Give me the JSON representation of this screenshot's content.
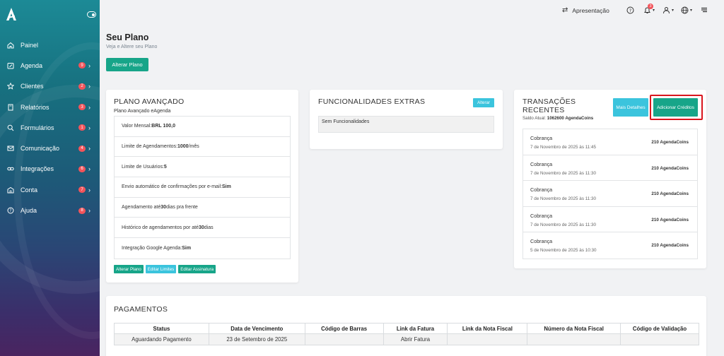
{
  "sidebar": {
    "items": [
      {
        "label": "Painel",
        "icon": "home-icon",
        "badge": ""
      },
      {
        "label": "Agenda",
        "icon": "calendar-edit-icon",
        "badge": "9"
      },
      {
        "label": "Clientes",
        "icon": "star-icon",
        "badge": "2"
      },
      {
        "label": "Relatórios",
        "icon": "book-icon",
        "badge": "3"
      },
      {
        "label": "Formulários",
        "icon": "search-icon",
        "badge": "1"
      },
      {
        "label": "Comunicação",
        "icon": "mail-icon",
        "badge": "4"
      },
      {
        "label": "Integrações",
        "icon": "link-icon",
        "badge": "6"
      },
      {
        "label": "Conta",
        "icon": "building-icon",
        "badge": "7"
      },
      {
        "label": "Ajuda",
        "icon": "help-icon",
        "badge": "8"
      }
    ]
  },
  "topbar": {
    "presentation_label": "Apresentação",
    "notification_count": "3"
  },
  "header": {
    "title": "Seu Plano",
    "subtitle": "Veja e Altere seu Plano",
    "change_plan_label": "Alterar Plano"
  },
  "plan": {
    "title": "PLANO AVANÇADO",
    "subtitle": "Plano Avançado eAgenda",
    "rows": [
      {
        "pre": "Valor Mensal: ",
        "bold": "BRL 100,0",
        "post": ""
      },
      {
        "pre": "Limite de Agendamentos: ",
        "bold": "1000",
        "post": "/mês"
      },
      {
        "pre": "Limite de Usuários: ",
        "bold": "5",
        "post": ""
      },
      {
        "pre": "Envio automático de confirmações por e-mail: ",
        "bold": "Sim",
        "post": ""
      },
      {
        "pre": "Agendamento até ",
        "bold": "30",
        "post": " dias pra frente"
      },
      {
        "pre": "Histórico de agendamentos por até ",
        "bold": "30",
        "post": " dias"
      },
      {
        "pre": "Integração Google Agenda: ",
        "bold": "Sim",
        "post": ""
      }
    ],
    "buttons": {
      "change": "Alterar Plano",
      "edit_limits": "Editar Limites",
      "edit_subscription": "Editar Assinatura"
    }
  },
  "extras": {
    "title": "FUNCIONALIDADES EXTRAS",
    "change_label": "Alterar",
    "empty_text": "Sem Funcionalidades"
  },
  "transactions": {
    "title": "TRANSAÇÕES RECENTES",
    "saldo_label": "Saldo Atual: ",
    "saldo_value": "1062600 AgendaCoins",
    "more_label": "Mais Detalhes",
    "add_label": "Adicionar Créditos",
    "items": [
      {
        "name": "Cobrança",
        "date": "7 de Novembro de 2025 às 11:45",
        "amount": "210 AgendaCoins"
      },
      {
        "name": "Cobrança",
        "date": "7 de Novembro de 2025 às 11:30",
        "amount": "210 AgendaCoins"
      },
      {
        "name": "Cobrança",
        "date": "7 de Novembro de 2025 às 11:30",
        "amount": "210 AgendaCoins"
      },
      {
        "name": "Cobrança",
        "date": "7 de Novembro de 2025 às 11:30",
        "amount": "210 AgendaCoins"
      },
      {
        "name": "Cobrança",
        "date": "5 de Novembro de 2025 às 10:30",
        "amount": "210 AgendaCoins"
      }
    ]
  },
  "payments": {
    "title": "PAGAMENTOS",
    "columns": [
      "Status",
      "Data de Vencimento",
      "Código de Barras",
      "Link da Fatura",
      "Link da Nota Fiscal",
      "Número da Nota Fiscal",
      "Código de Validação"
    ],
    "rows": [
      {
        "status": "Aguardando Pagamento",
        "due": "23 de Setembro de 2025",
        "barcode": "",
        "invoice_link": "Abrir Fatura",
        "nf_link": "",
        "nf_number": "",
        "validation": ""
      }
    ]
  },
  "colors": {
    "accent": "#17a589",
    "info": "#3bc4dd",
    "danger": "#e0454c",
    "highlight": "#d9161e"
  }
}
